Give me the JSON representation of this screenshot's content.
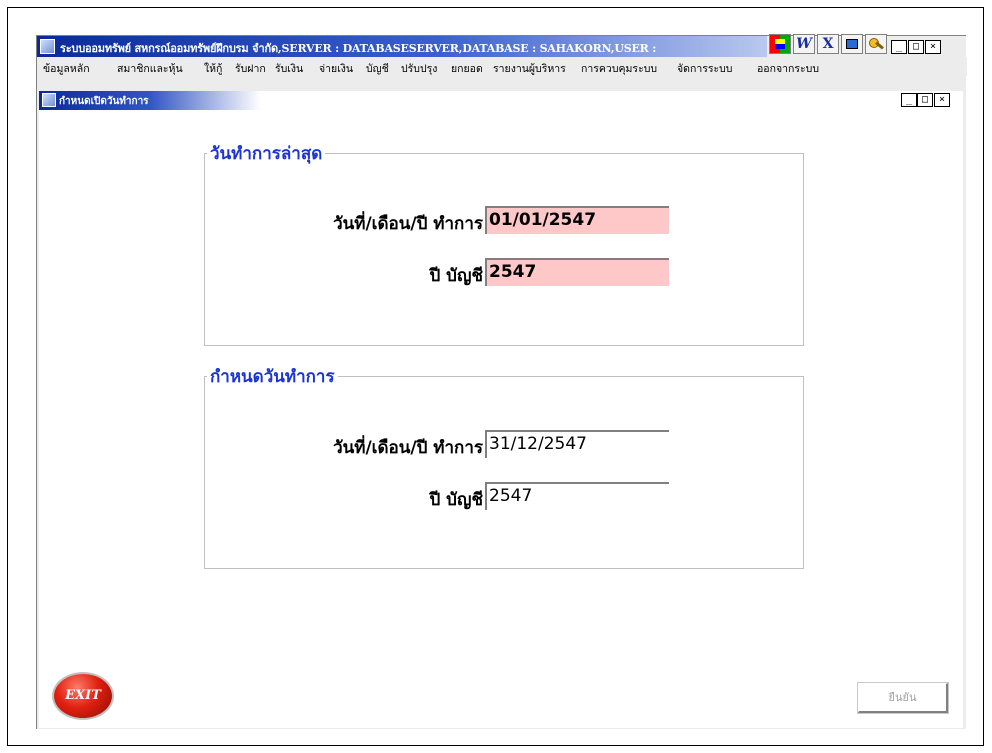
{
  "window": {
    "title": "ระบบออมทรัพย์ สหกรณ์ออมทรัพย์ฝึกบรม จำกัด,SERVER : DATABASESERVER,DATABASE : SAHAKORN,USER :",
    "minimize": "_",
    "maximize": "□",
    "close": "×"
  },
  "toolbar": {
    "icons": [
      "window-grid-icon",
      "word-icon",
      "excel-icon",
      "picture-icon",
      "key-icon"
    ],
    "word_glyph": "W",
    "excel_glyph": "X"
  },
  "menu": {
    "items": [
      "ข้อมูลหลัก",
      "สมาชิกและหุ้น",
      "ให้กู้",
      "รับฝาก",
      "รับเงิน",
      "จ่ายเงิน",
      "บัญชี",
      "ปรับปรุง",
      "ยกยอด",
      "รายงานผู้บริหาร",
      "การควบคุมระบบ",
      "จัดการระบบ",
      "ออกจากระบบ"
    ]
  },
  "child_window": {
    "title": "กำหนดเปิดวันทำการ",
    "minimize": "_",
    "maximize": "□",
    "close": "×"
  },
  "last_workday": {
    "legend": "วันทำการล่าสุด",
    "date_label": "วันที่/เดือน/ปี ทำการ",
    "date_value": "01/01/2547",
    "year_label": "ปี บัญชี",
    "year_value": "2547"
  },
  "set_workday": {
    "legend": "กำหนดวันทำการ",
    "date_label": "วันที่/เดือน/ปี ทำการ",
    "date_value": "31/12/2547",
    "year_label": "ปี บัญชี",
    "year_value": "2547"
  },
  "buttons": {
    "exit_label": "EXIT",
    "confirm_label": "ยืนยัน"
  },
  "colors": {
    "title_blue": "#0a2a9a",
    "legend_blue": "#1b34d6",
    "readonly_bg": "#ffc8c8"
  }
}
